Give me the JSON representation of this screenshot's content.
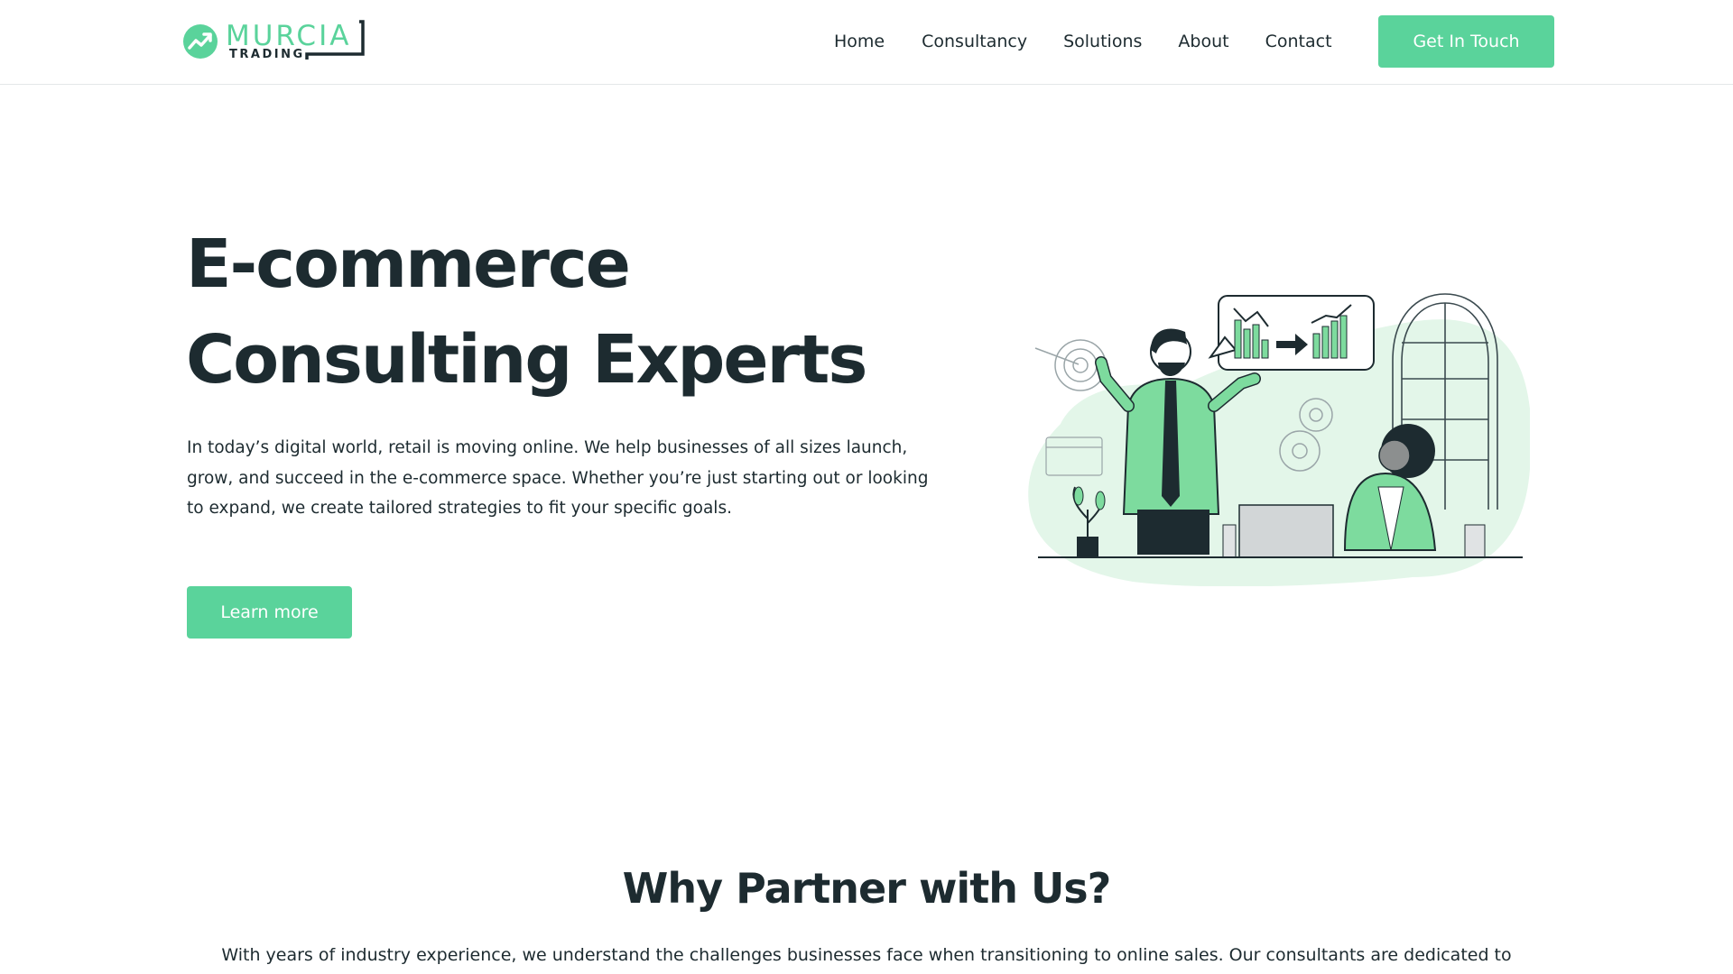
{
  "brand": {
    "name": "MURCIA",
    "subtitle": "TRADING",
    "accent_color": "#5ad39b",
    "dark_color": "#1d2b30"
  },
  "nav": {
    "items": [
      {
        "label": "Home"
      },
      {
        "label": "Consultancy"
      },
      {
        "label": "Solutions"
      },
      {
        "label": "About"
      },
      {
        "label": "Contact"
      }
    ],
    "cta_label": "Get In Touch"
  },
  "hero": {
    "title_line1": "E-commerce",
    "title_line2": "Consulting Experts",
    "body": "In today’s digital world, retail is moving online. We help businesses of all sizes launch, grow, and succeed in the e-commerce space. Whether you’re just starting out or looking to expand, we create tailored strategies to fit your specific goals.",
    "button_label": "Learn more",
    "illustration_icon": "business-consultants-illustration"
  },
  "why": {
    "title": "Why Partner with Us?",
    "body": "With years of industry experience, we understand the challenges businesses face when transitioning to online sales. Our consultants are dedicated to"
  }
}
